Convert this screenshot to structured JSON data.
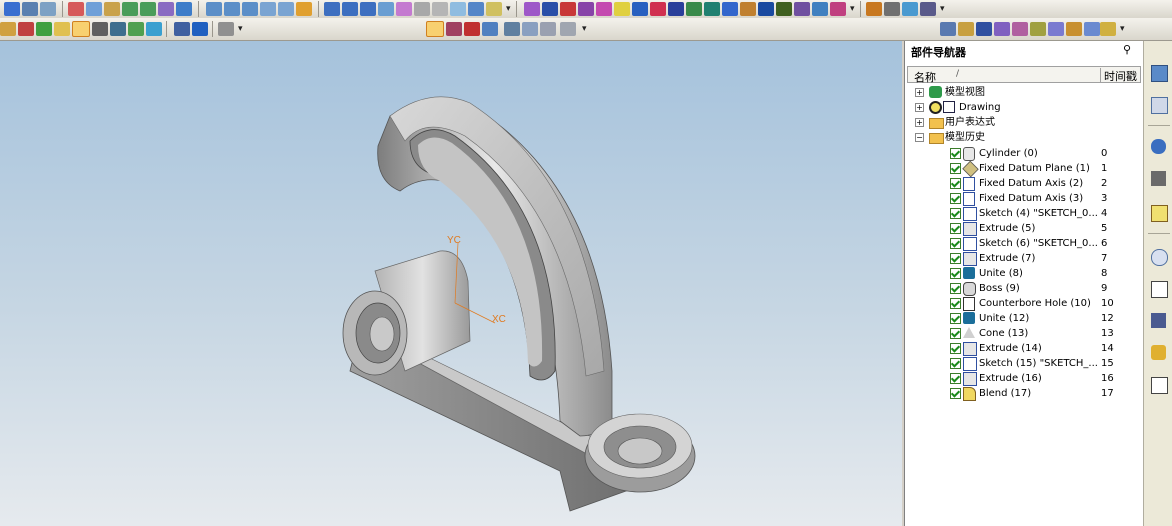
{
  "navigator": {
    "title": "部件导航器",
    "columns": {
      "name": "名称",
      "sort_indicator": "/",
      "time": "时间戳"
    },
    "top_nodes": [
      {
        "label": "模型视图",
        "expander": "+",
        "icon": "model-views-icon"
      },
      {
        "label": "Drawing",
        "expander": "+",
        "icon": "drawing-icon"
      },
      {
        "label": "用户表达式",
        "expander": "+",
        "icon": "folder-icon"
      },
      {
        "label": "模型历史",
        "expander": "−",
        "icon": "open-folder-icon"
      }
    ],
    "features": [
      {
        "label": "Cylinder (0)",
        "time": "0",
        "icon": "cylinder-icon"
      },
      {
        "label": "Fixed Datum Plane (1)",
        "time": "1",
        "icon": "datum-plane-icon"
      },
      {
        "label": "Fixed Datum Axis (2)",
        "time": "2",
        "icon": "datum-axis-icon"
      },
      {
        "label": "Fixed Datum Axis (3)",
        "time": "3",
        "icon": "datum-axis-icon"
      },
      {
        "label": "Sketch (4) \"SKETCH_0...",
        "time": "4",
        "icon": "sketch-icon"
      },
      {
        "label": "Extrude (5)",
        "time": "5",
        "icon": "extrude-icon"
      },
      {
        "label": "Sketch (6) \"SKETCH_0...",
        "time": "6",
        "icon": "sketch-icon"
      },
      {
        "label": "Extrude (7)",
        "time": "7",
        "icon": "extrude-icon"
      },
      {
        "label": "Unite (8)",
        "time": "8",
        "icon": "unite-icon"
      },
      {
        "label": "Boss (9)",
        "time": "9",
        "icon": "boss-icon"
      },
      {
        "label": "Counterbore Hole (10)",
        "time": "10",
        "icon": "hole-icon"
      },
      {
        "label": "Unite (12)",
        "time": "12",
        "icon": "unite-icon"
      },
      {
        "label": "Cone (13)",
        "time": "13",
        "icon": "cone-icon"
      },
      {
        "label": "Extrude (14)",
        "time": "14",
        "icon": "extrude-icon"
      },
      {
        "label": "Sketch (15) \"SKETCH_...",
        "time": "15",
        "icon": "sketch-icon"
      },
      {
        "label": "Extrude (16)",
        "time": "16",
        "icon": "extrude-icon"
      },
      {
        "label": "Blend (17)",
        "time": "17",
        "icon": "blend-icon"
      }
    ]
  },
  "viewport": {
    "axis_labels": {
      "yc": "YC",
      "xc": "XC"
    }
  },
  "colors": {
    "viewport_top": "#a5c2dc",
    "viewport_bottom": "#e6eaee",
    "part_gray": "#9a9a9a",
    "axis_label": "#e07a20",
    "checkbox_green": "#1a8a1a"
  }
}
